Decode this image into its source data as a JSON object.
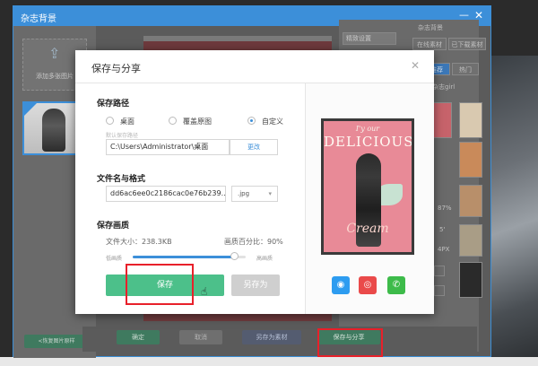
{
  "outer_window": {
    "title": "杂志背景",
    "minimize_glyph": "—",
    "close_glyph": "✕"
  },
  "left_panel": {
    "upload_label": "添加多张图片",
    "upload_icon": "upload-icon",
    "reset_label": "<恢复图片原样"
  },
  "right_panel": {
    "quality_select": "精致设置",
    "top_label": "杂志背景",
    "tab_a": "在线素材",
    "tab_b": "已下载素材",
    "tab_c": "推荐",
    "tab_d": "热门",
    "small_label": "杂志girl",
    "values": [
      "87%",
      "5'",
      "4PX"
    ]
  },
  "bottom_bar": {
    "confirm": "确定",
    "cancel": "取消",
    "save_as_material": "另存为素材",
    "save_and_share": "保存与分享"
  },
  "dialog": {
    "title": "保存与分享",
    "close_glyph": "✕",
    "save_path_title": "保存路径",
    "radio_desktop": "桌面",
    "radio_overwrite": "覆盖原图",
    "radio_custom": "自定义",
    "selected_radio": "自定义",
    "path_hint": "默认保存路径",
    "path_value": "C:\\Users\\Administrator\\桌面",
    "change_button": "更改",
    "name_format_title": "文件名与格式",
    "file_name": "dd6ac6ee0c2186cac0e76b239...",
    "format": ".jpg",
    "quality_title": "保存画质",
    "file_size": "文件大小：238.3KB",
    "quality_percent": "画质百分比：90%",
    "quality_value": 0.9,
    "low_label": "低画质",
    "high_label": "高画质",
    "save_button": "保存",
    "save_as_button": "另存为",
    "poster_line1": "I'y our",
    "poster_line2": "DELICIOUS",
    "poster_line3": "Cream",
    "share_qq": "qq-icon",
    "share_weibo": "weibo-icon",
    "share_wechat": "wechat-icon"
  },
  "colors": {
    "accent_blue": "#3c8fd9",
    "save_green": "#4cc08a",
    "highlight_red": "#e8202a",
    "poster_pink": "#e88a97"
  }
}
